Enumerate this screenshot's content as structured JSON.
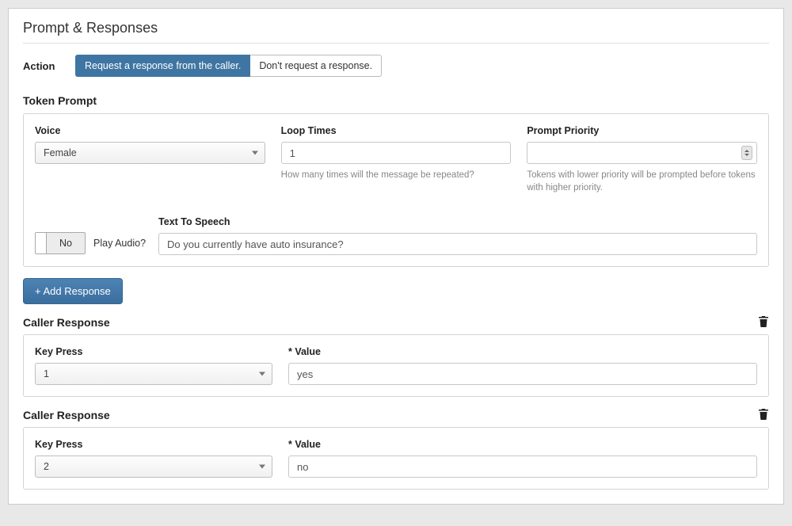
{
  "page": {
    "title": "Prompt & Responses"
  },
  "action": {
    "label": "Action",
    "options": [
      "Request a response from the caller.",
      "Don't request a response."
    ]
  },
  "tokenPrompt": {
    "title": "Token Prompt",
    "voice": {
      "label": "Voice",
      "value": "Female"
    },
    "loopTimes": {
      "label": "Loop Times",
      "value": "1",
      "help": "How many times will the message be repeated?"
    },
    "promptPriority": {
      "label": "Prompt Priority",
      "value": "",
      "help": "Tokens with lower priority will be prompted before tokens with higher priority."
    },
    "playAudio": {
      "value": "No",
      "label": "Play Audio?"
    },
    "tts": {
      "label": "Text To Speech",
      "value": "Do you currently have auto insurance?"
    }
  },
  "addResponseButton": "+ Add Response",
  "responses": [
    {
      "title": "Caller Response",
      "keyPress": {
        "label": "Key Press",
        "value": "1"
      },
      "value": {
        "label": "* Value",
        "value": "yes"
      }
    },
    {
      "title": "Caller Response",
      "keyPress": {
        "label": "Key Press",
        "value": "2"
      },
      "value": {
        "label": "* Value",
        "value": "no"
      }
    }
  ]
}
